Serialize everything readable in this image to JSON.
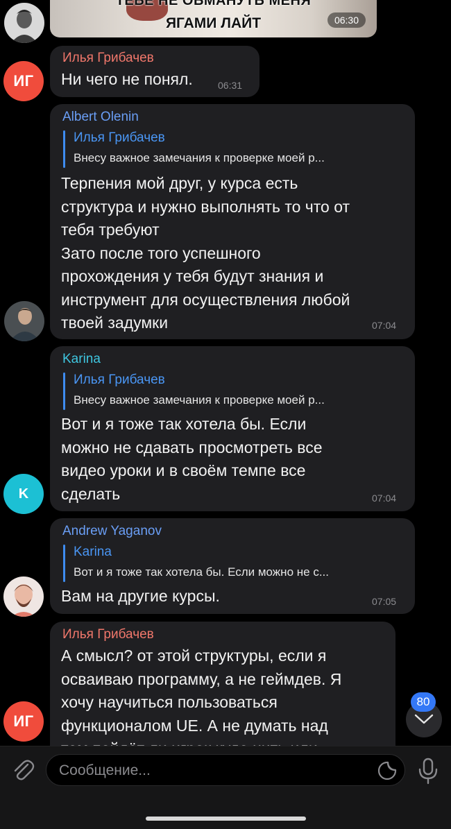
{
  "messages": [
    {
      "kind": "image",
      "caption_line1": "ТЕБЕ НЕ ОБМАНУТЬ МЕНЯ",
      "caption_line2": "ЯГАМИ ЛАЙТ",
      "time": "06:30"
    },
    {
      "sender": "Илья Грибачев",
      "sender_color": "#f0776b",
      "avatar_initials": "ИГ",
      "text": "Ни чего не понял.",
      "time": "06:31"
    },
    {
      "sender": "Albert Olenin",
      "sender_color": "#6a9ef5",
      "reply_to": "Илья Грибачев",
      "reply_text": "Внесу важное замечания к проверке моей р...",
      "text": "Терпения мой друг, у курса есть\nструктура и нужно выполнять то что от\nтебя требуют\nЗато после того успешного\nпрохождения у тебя будут знания и\nинструмент для осуществления любой\nтвоей задумки",
      "time": "07:04"
    },
    {
      "sender": "Karina",
      "sender_color": "#3fc6e0",
      "avatar_initials": "K",
      "reply_to": "Илья Грибачев",
      "reply_text": "Внесу важное замечания к проверке моей р...",
      "text": "Вот и я тоже так хотела бы. Если\nможно не сдавать просмотреть все\nвидео уроки и в своём темпе все\nсделать",
      "time": "07:04"
    },
    {
      "sender": "Andrew Yaganov",
      "sender_color": "#6a9ef5",
      "reply_to": "Karina",
      "reply_text": "Вот и я тоже так хотела бы. Если можно не с...",
      "text": "Вам на другие курсы.",
      "time": "07:05"
    },
    {
      "sender": "Илья Грибачев",
      "sender_color": "#f0776b",
      "avatar_initials": "ИГ",
      "text": "А смысл? от этой структуры, если я\nосваиваю программу, а не геймдев. Я\nхочу научиться пользоваться\nфункционалом UE. А не думать над\nтем пойдёт ли игрок куда нить или"
    }
  ],
  "scroll_badge": "80",
  "composer": {
    "placeholder": "Сообщение..."
  },
  "icons": {
    "attach": "paperclip-icon",
    "sticker": "sticker-icon",
    "mic": "microphone-icon",
    "scroll": "chevron-down-icon"
  }
}
